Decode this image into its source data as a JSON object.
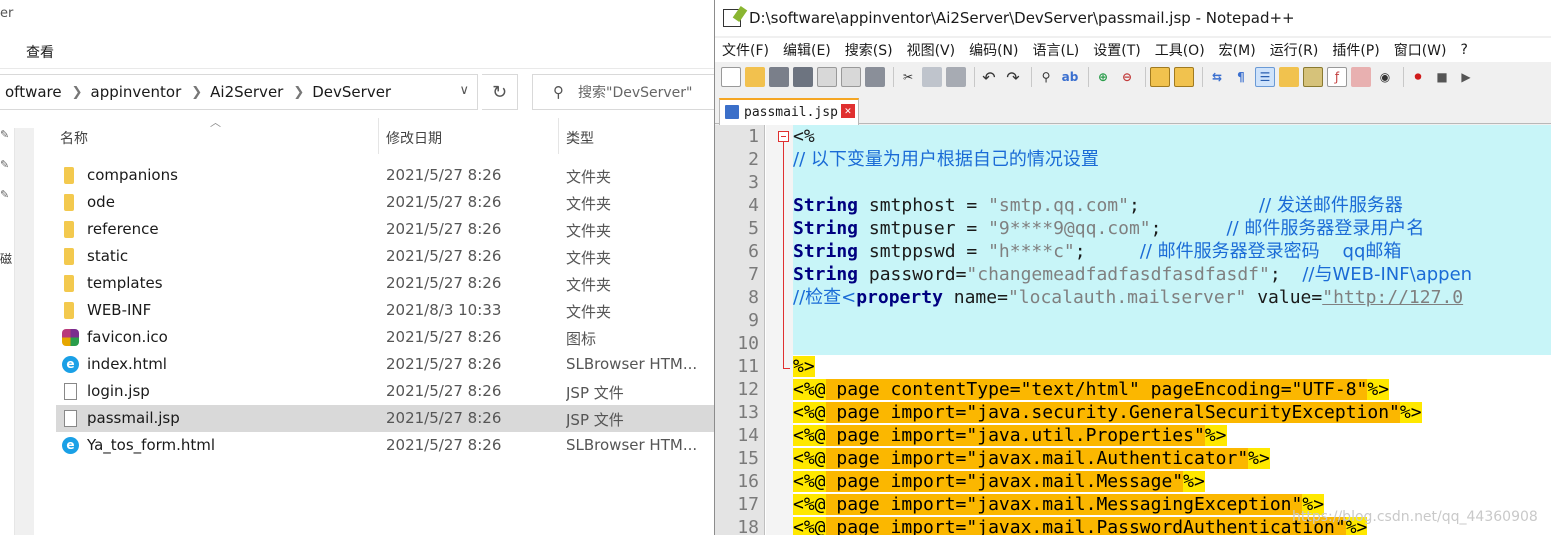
{
  "explorer": {
    "title_fragment": "er",
    "ribbon_view": "查看",
    "breadcrumbs": [
      "oftware",
      "appinventor",
      "Ai2Server",
      "DevServer"
    ],
    "search_placeholder": "搜索\"DevServer\"",
    "nav_clip_text": "磁",
    "columns": {
      "name": "名称",
      "date": "修改日期",
      "type": "类型"
    },
    "files": [
      {
        "name": "companions",
        "date": "2021/5/27 8:26",
        "type": "文件夹",
        "icon": "folder-icon"
      },
      {
        "name": "ode",
        "date": "2021/5/27 8:26",
        "type": "文件夹",
        "icon": "folder-icon"
      },
      {
        "name": "reference",
        "date": "2021/5/27 8:26",
        "type": "文件夹",
        "icon": "folder-icon"
      },
      {
        "name": "static",
        "date": "2021/5/27 8:26",
        "type": "文件夹",
        "icon": "folder-icon"
      },
      {
        "name": "templates",
        "date": "2021/5/27 8:26",
        "type": "文件夹",
        "icon": "folder-icon"
      },
      {
        "name": "WEB-INF",
        "date": "2021/8/3 10:33",
        "type": "文件夹",
        "icon": "folder-icon"
      },
      {
        "name": "favicon.ico",
        "date": "2021/5/27 8:26",
        "type": "图标",
        "icon": "favicon-icon"
      },
      {
        "name": "index.html",
        "date": "2021/5/27 8:26",
        "type": "SLBrowser HTM...",
        "icon": "browser-icon"
      },
      {
        "name": "login.jsp",
        "date": "2021/5/27 8:26",
        "type": "JSP 文件",
        "icon": "file-icon"
      },
      {
        "name": "passmail.jsp",
        "date": "2021/5/27 8:26",
        "type": "JSP 文件",
        "icon": "file-icon",
        "selected": true
      },
      {
        "name": "Ya_tos_form.html",
        "date": "2021/5/27 8:26",
        "type": "SLBrowser HTM...",
        "icon": "browser-icon"
      }
    ]
  },
  "npp": {
    "title": "D:\\software\\appinventor\\Ai2Server\\DevServer\\passmail.jsp - Notepad++",
    "menu": [
      "文件(F)",
      "编辑(E)",
      "搜索(S)",
      "视图(V)",
      "编码(N)",
      "语言(L)",
      "设置(T)",
      "工具(O)",
      "宏(M)",
      "运行(R)",
      "插件(P)",
      "窗口(W)",
      "?"
    ],
    "tab_label": "passmail.jsp",
    "tab_close": "✕",
    "lines": {
      "l1": "<%",
      "l2": "// 以下变量为用户根据自己的情况设置",
      "l4_kw": "String",
      "l4_a": " smtphost = ",
      "l4_s": "\"smtp.qq.com\"",
      "l4_b": ";           ",
      "l4_c": "// 发送邮件服务器",
      "l5_kw": "String",
      "l5_a": " smtpuser = ",
      "l5_s": "\"9****9@qq.com\"",
      "l5_b": ";      ",
      "l5_c": "// 邮件服务器登录用户名",
      "l6_kw": "String",
      "l6_a": " smtppswd = ",
      "l6_s": "\"h****c\"",
      "l6_b": ";     ",
      "l6_c": "// 邮件服务器登录密码    qq邮箱",
      "l7_kw": "String",
      "l7_a": " password=",
      "l7_s": "\"changemeadfadfasdfasdfasdf\"",
      "l7_b": ";  ",
      "l7_c": "//与WEB-INF\\appen",
      "l8_c1": "//检查<",
      "l8_kw": "property",
      "l8_a": " name=",
      "l8_s": "\"localauth.mailserver\"",
      "l8_b": " value=",
      "l8_l": "\"http://127.0",
      "l11": "%>",
      "l12_attr": " page contentType=",
      "l12_s1": "\"text/html\"",
      "l12_attr2": " pageEncoding=",
      "l12_s2": "\"UTF-8\"",
      "l13_attr": " page import=",
      "l13_s": "\"java.security.GeneralSecurityException\"",
      "l14_attr": " page import=",
      "l14_s": "\"java.util.Properties\"",
      "l15_attr": " page import=",
      "l15_s": "\"javax.mail.Authenticator\"",
      "l16_attr": " page import=",
      "l16_s": "\"javax.mail.Message\"",
      "l17_attr": " page import=",
      "l17_s": "\"javax.mail.MessagingException\"",
      "l18_attr": " page import=",
      "l18_s": "\"javax.mail.PasswordAuthentication\"",
      "dir_open": "<%@",
      "dir_close": "%>"
    }
  },
  "watermark": "https://blog.csdn.net/qq_44360908",
  "colors": {
    "cyan_bg": "#c8f5f8",
    "directive_yellow": "#ffe800",
    "attr_orange": "#fbb700",
    "keyword": "#000080",
    "comment": "#1a6bd6",
    "selection": "#d9d9d9"
  }
}
